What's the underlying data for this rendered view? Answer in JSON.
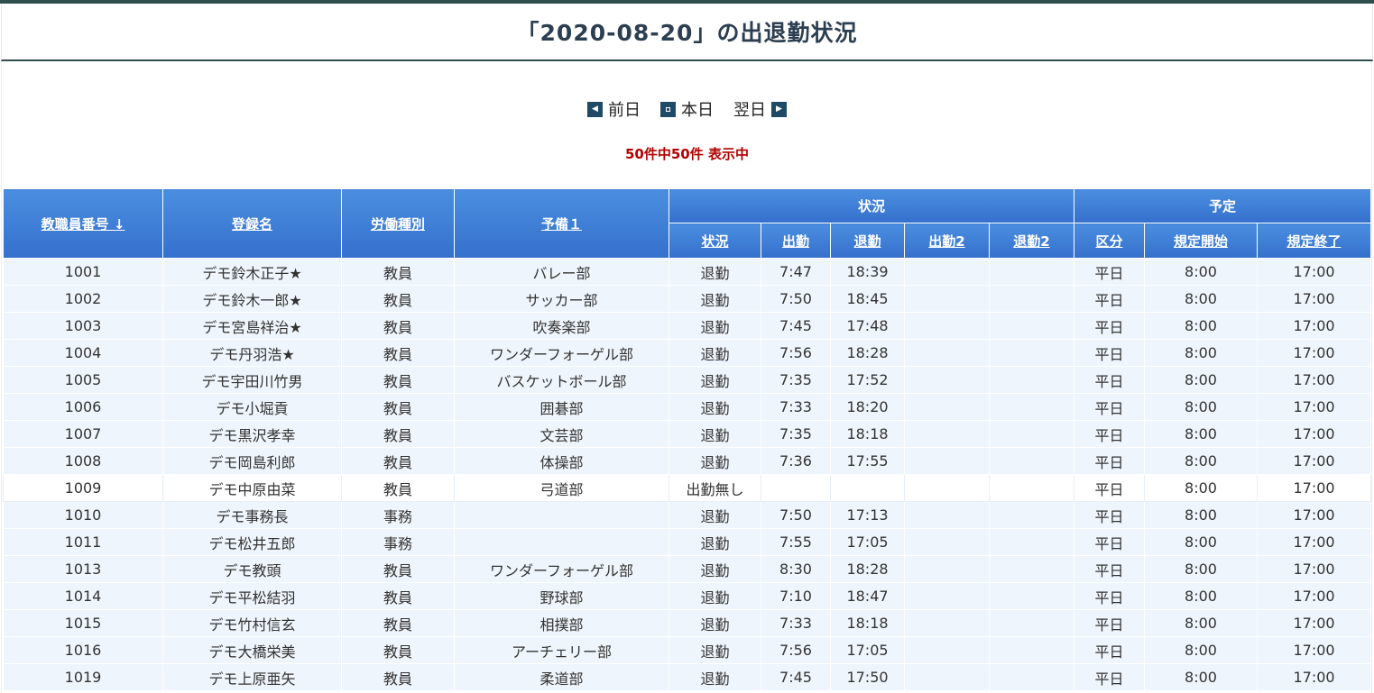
{
  "page": {
    "title": "「2020-08-20」の出退勤状況"
  },
  "nav": {
    "prev_label": "前日",
    "today_label": "本日",
    "next_label": "翌日"
  },
  "count_text": "50件中50件 表示中",
  "table": {
    "headers": {
      "id": "教職員番号 ↓",
      "name": "登録名",
      "labor_type": "労働種別",
      "spare1": "予備１",
      "status_group": "状況",
      "plan_group": "予定",
      "status": "状況",
      "in1": "出勤",
      "out1": "退勤",
      "in2": "出勤2",
      "out2": "退勤2",
      "category": "区分",
      "plan_start": "規定開始",
      "plan_end": "規定終了"
    },
    "rows": [
      [
        "1001",
        "デモ鈴木正子★",
        "教員",
        "バレー部",
        "退勤",
        "7:47",
        "18:39",
        "",
        "",
        "平日",
        "8:00",
        "17:00"
      ],
      [
        "1002",
        "デモ鈴木一郎★",
        "教員",
        "サッカー部",
        "退勤",
        "7:50",
        "18:45",
        "",
        "",
        "平日",
        "8:00",
        "17:00"
      ],
      [
        "1003",
        "デモ宮島祥治★",
        "教員",
        "吹奏楽部",
        "退勤",
        "7:45",
        "17:48",
        "",
        "",
        "平日",
        "8:00",
        "17:00"
      ],
      [
        "1004",
        "デモ丹羽浩★",
        "教員",
        "ワンダーフォーゲル部",
        "退勤",
        "7:56",
        "18:28",
        "",
        "",
        "平日",
        "8:00",
        "17:00"
      ],
      [
        "1005",
        "デモ宇田川竹男",
        "教員",
        "バスケットボール部",
        "退勤",
        "7:35",
        "17:52",
        "",
        "",
        "平日",
        "8:00",
        "17:00"
      ],
      [
        "1006",
        "デモ小堀貢",
        "教員",
        "囲碁部",
        "退勤",
        "7:33",
        "18:20",
        "",
        "",
        "平日",
        "8:00",
        "17:00"
      ],
      [
        "1007",
        "デモ黒沢孝幸",
        "教員",
        "文芸部",
        "退勤",
        "7:35",
        "18:18",
        "",
        "",
        "平日",
        "8:00",
        "17:00"
      ],
      [
        "1008",
        "デモ岡島利郎",
        "教員",
        "体操部",
        "退勤",
        "7:36",
        "17:55",
        "",
        "",
        "平日",
        "8:00",
        "17:00"
      ],
      [
        "1009",
        "デモ中原由菜",
        "教員",
        "弓道部",
        "出勤無し",
        "",
        "",
        "",
        "",
        "平日",
        "8:00",
        "17:00"
      ],
      [
        "1010",
        "デモ事務長",
        "事務",
        "",
        "退勤",
        "7:50",
        "17:13",
        "",
        "",
        "平日",
        "8:00",
        "17:00"
      ],
      [
        "1011",
        "デモ松井五郎",
        "事務",
        "",
        "退勤",
        "7:55",
        "17:05",
        "",
        "",
        "平日",
        "8:00",
        "17:00"
      ],
      [
        "1013",
        "デモ教頭",
        "教員",
        "ワンダーフォーゲル部",
        "退勤",
        "8:30",
        "18:28",
        "",
        "",
        "平日",
        "8:00",
        "17:00"
      ],
      [
        "1014",
        "デモ平松結羽",
        "教員",
        "野球部",
        "退勤",
        "7:10",
        "18:47",
        "",
        "",
        "平日",
        "8:00",
        "17:00"
      ],
      [
        "1015",
        "デモ竹村信玄",
        "教員",
        "相撲部",
        "退勤",
        "7:33",
        "18:18",
        "",
        "",
        "平日",
        "8:00",
        "17:00"
      ],
      [
        "1016",
        "デモ大橋栄美",
        "教員",
        "アーチェリー部",
        "退勤",
        "7:56",
        "17:05",
        "",
        "",
        "平日",
        "8:00",
        "17:00"
      ],
      [
        "1019",
        "デモ上原亜矢",
        "教員",
        "柔道部",
        "退勤",
        "7:45",
        "17:50",
        "",
        "",
        "平日",
        "8:00",
        "17:00"
      ]
    ]
  }
}
